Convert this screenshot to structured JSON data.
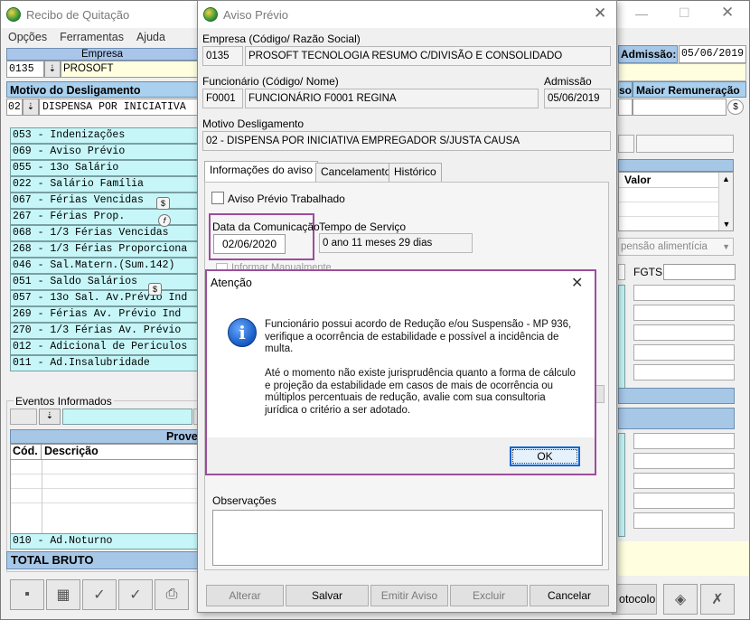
{
  "main": {
    "title": "Recibo de Quitação",
    "menu": [
      "Opções",
      "Ferramentas",
      "Ajuda"
    ],
    "empresa_label": "Empresa",
    "empresa_code": "0135",
    "empresa_name": "PROSOFT",
    "admissao_label": "Admissão:",
    "admissao_value": "05/06/2019",
    "motivo_header": "Motivo do Desligamento",
    "motivo_code": "02",
    "motivo_text": "DISPENSA POR INICIATIVA",
    "col_so": "so",
    "col_maior": "Maior Remuneração",
    "verbas": [
      "053 - Indenizações",
      "069 - Aviso Prévio",
      "055 - 13o Salário",
      "022 - Salário Família",
      "067 - Férias Vencidas",
      "267 - Férias Prop.",
      "068 - 1/3 Férias Vencidas",
      "268 - 1/3 Férias Proporciona",
      "046 - Sal.Matern.(Sum.142)",
      "051 - Saldo Salários",
      "057 - 13o Sal. Av.Prévio Ind",
      "269 -  Férias  Av. Prévio Ind",
      "270 - 1/3 Férias Av. Prévio",
      "012 - Adicional de Periculos",
      "011 - Ad.Insalubridade"
    ],
    "valor_header": "Valor",
    "pensao_label": "pensão alimentícia",
    "fgts_label": "FGTS",
    "eventos_label": "Eventos Informados",
    "proventos_header": "Prove",
    "cod_header": "Cód.",
    "descricao_header": "Descrição",
    "ad_noturno": "010 - Ad.Noturno",
    "total_bruto": "TOTAL BRUTO",
    "protocolo_label": "otocolo"
  },
  "aviso": {
    "title": "Aviso Prévio",
    "empresa_label": "Empresa (Código/ Razão Social)",
    "empresa_code": "0135",
    "empresa_name": "PROSOFT TECNOLOGIA RESUMO C/DIVISÃO E CONSOLIDADO",
    "funcionario_label": "Funcionário (Código/ Nome)",
    "funcionario_code": "F0001",
    "funcionario_name": "FUNCIONÁRIO F0001 REGINA",
    "admissao_label": "Admissão",
    "admissao_value": "05/06/2019",
    "motivo_label": "Motivo Desligamento",
    "motivo_value": "02 - DISPENSA POR INICIATIVA EMPREGADOR S/JUSTA CAUSA",
    "tabs": [
      "Informações do aviso",
      "Cancelamento",
      "Histórico"
    ],
    "trabalhado_label": "Aviso Prévio Trabalhado",
    "data_com_label": "Data da Comunicação",
    "data_com_value": "02/06/2020",
    "tempo_label": "Tempo de Serviço",
    "tempo_value": "0 ano 11 meses 29 dias",
    "informar_label": "Informar Manualmente",
    "observacoes_label": "Observações",
    "buttons": [
      "Alterar",
      "Salvar",
      "Emitir Aviso",
      "Excluir",
      "Cancelar"
    ]
  },
  "dialog": {
    "title": "Atenção",
    "message1": "Funcionário possui acordo de Redução e/ou Suspensão - MP 936, verifique a ocorrência de estabilidade e possível a incidência de multa.",
    "message2": "Até o momento não existe jurisprudência quanto a forma de cálculo e projeção da estabilidade em casos de mais de ocorrência ou múltiplos percentuais de redução, avalie com sua consultoria jurídica o critério a ser adotado.",
    "ok_label": "OK"
  }
}
